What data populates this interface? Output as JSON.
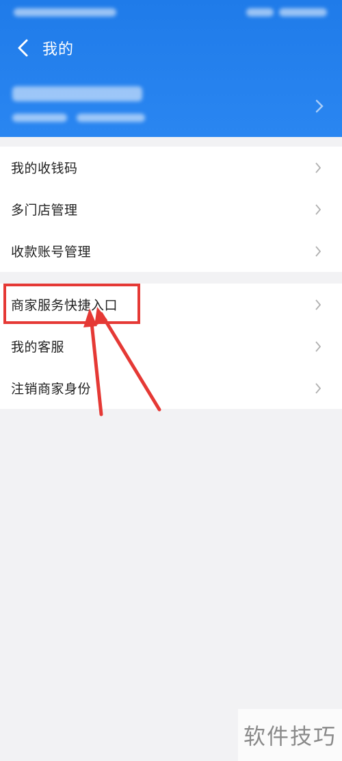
{
  "header": {
    "title": "我的",
    "background_color": "#2a86f1"
  },
  "menu_group_1": [
    {
      "label": "我的收钱码"
    },
    {
      "label": "多门店管理"
    },
    {
      "label": "收款账号管理"
    }
  ],
  "menu_group_2": [
    {
      "label": "商家服务快捷入口",
      "highlighted": true
    },
    {
      "label": "我的客服"
    },
    {
      "label": "注销商家身份"
    }
  ],
  "annotation": {
    "highlight_color": "#e53935"
  },
  "watermark": {
    "text": "软件技巧"
  }
}
